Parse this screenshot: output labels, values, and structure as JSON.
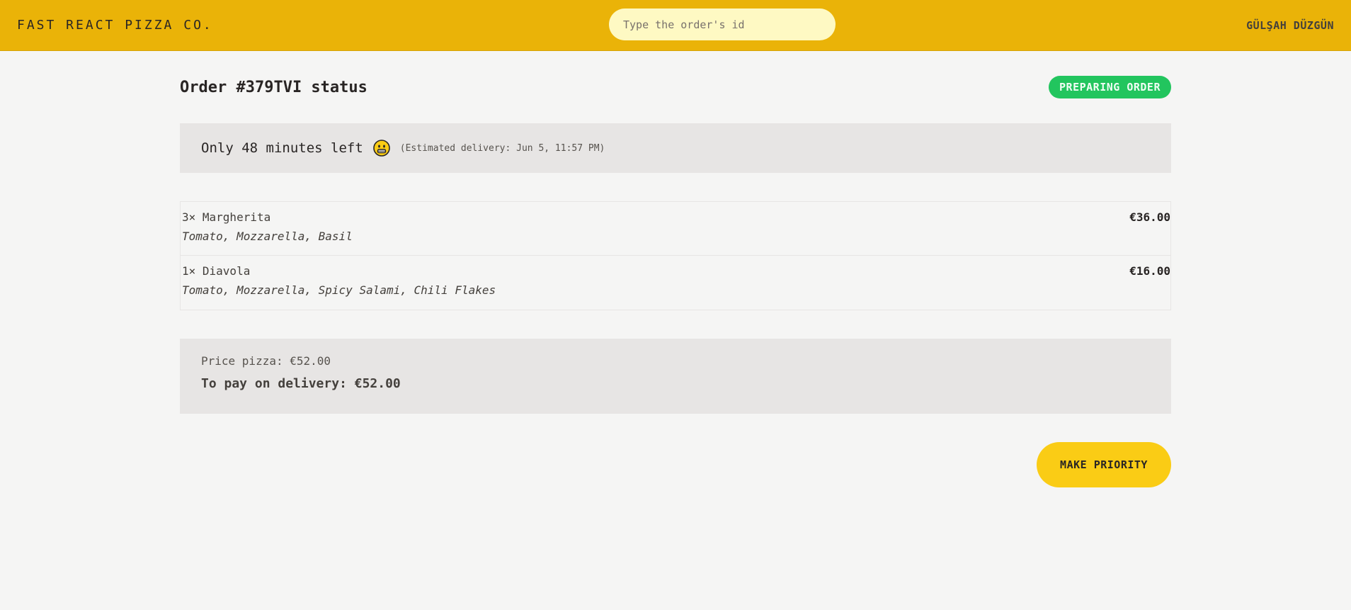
{
  "header": {
    "logo": "Fast React Pizza Co.",
    "search_placeholder": "Type the order's id",
    "search_value": "",
    "username": "GÜLŞAH DÜZGÜN"
  },
  "order": {
    "title": "Order #379TVI status",
    "status_badge": "PREPARING ORDER",
    "eta_text": "Only 48 minutes left",
    "eta_icon": "grinning-face-emoji-icon",
    "estimated_delivery": "(Estimated delivery: Jun 5, 11:57 PM)"
  },
  "items": [
    {
      "qty_name": "3× Margherita",
      "price": "€36.00",
      "ingredients": "Tomato, Mozzarella, Basil"
    },
    {
      "qty_name": "1× Diavola",
      "price": "€16.00",
      "ingredients": "Tomato, Mozzarella, Spicy Salami, Chili Flakes"
    }
  ],
  "totals": {
    "price_pizza": "Price pizza: €52.00",
    "to_pay": "To pay on delivery: €52.00"
  },
  "actions": {
    "make_priority": "MAKE PRIORITY"
  },
  "colors": {
    "header_bg": "#eab308",
    "status_badge": "#22c55e",
    "button": "#facc15",
    "panel_bg": "#e7e5e4",
    "page_bg": "#f5f5f4"
  }
}
